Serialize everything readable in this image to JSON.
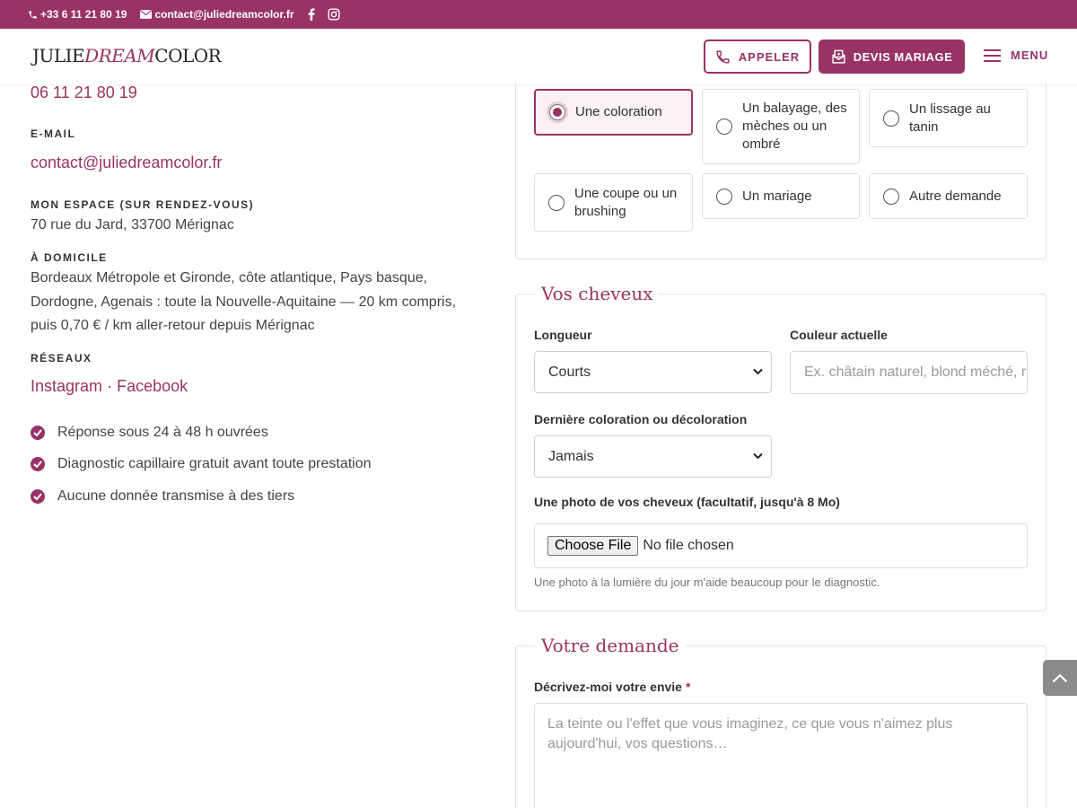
{
  "topbar": {
    "phone": "+33 6 11 21 80 19",
    "email": "contact@juliedreamcolor.fr",
    "social_icons": [
      "facebook-icon",
      "instagram-icon"
    ]
  },
  "header": {
    "logo_julie": "JULIE",
    "logo_dream": "DREAM",
    "logo_color": "COLOR",
    "call_label": "APPELER",
    "devis_label": "DEVIS MARIAGE",
    "menu_label": "MENU"
  },
  "contact": {
    "phone": "06 11 21 80 19",
    "email_label": "E-MAIL",
    "email": "contact@juliedreamcolor.fr",
    "space_label": "MON ESPACE (SUR RENDEZ-VOUS)",
    "address": "70 rue du Jard, 33700 Mérignac",
    "home_label": "À DOMICILE",
    "home_line1": "Bordeaux Métropole et Gironde, côte atlantique, Pays basque,",
    "home_line2": "Dordogne, Agenais : toute la Nouvelle-Aquitaine — 20 km compris,",
    "home_line3": "puis 0,70 € / km aller-retour depuis Mérignac",
    "networks_label": "RÉSEAUX",
    "instagram": "Instagram",
    "separator": "·",
    "facebook": "Facebook",
    "checks": [
      "Réponse sous 24 à 48 h ouvrées",
      "Diagnostic capillaire gratuit avant toute prestation",
      "Aucune donnée transmise à des tiers"
    ]
  },
  "services": {
    "selected": "Une coloration",
    "options": [
      "Une coloration",
      "Un balayage, des mèches ou un ombré",
      "Un lissage au tanin",
      "Une coupe ou un brushing",
      "Un mariage",
      "Autre demande"
    ]
  },
  "hair": {
    "legend": "Vos cheveux",
    "length_label": "Longueur",
    "length_value": "Courts",
    "color_label": "Couleur actuelle",
    "color_placeholder": "Ex. châtain naturel, blond méché, r",
    "last_label": "Dernière coloration ou décoloration",
    "last_value": "Jamais",
    "photo_label": "Une photo de vos cheveux (facultatif, jusqu'à 8 Mo)",
    "file_button": "Choose File",
    "file_status": "No file chosen",
    "photo_hint": "Une photo à la lumière du jour m'aide beaucoup pour le diagnostic."
  },
  "request": {
    "legend": "Votre demande",
    "desc_label": "Décrivez-moi votre envie",
    "required_mark": "*",
    "desc_placeholder": "La teinte ou l'effet que vous imaginez, ce que vous n'aimez plus aujourd'hui, vos questions…"
  },
  "colors": {
    "brand": "#993366",
    "text": "#333333",
    "border": "#e0e0e0"
  }
}
